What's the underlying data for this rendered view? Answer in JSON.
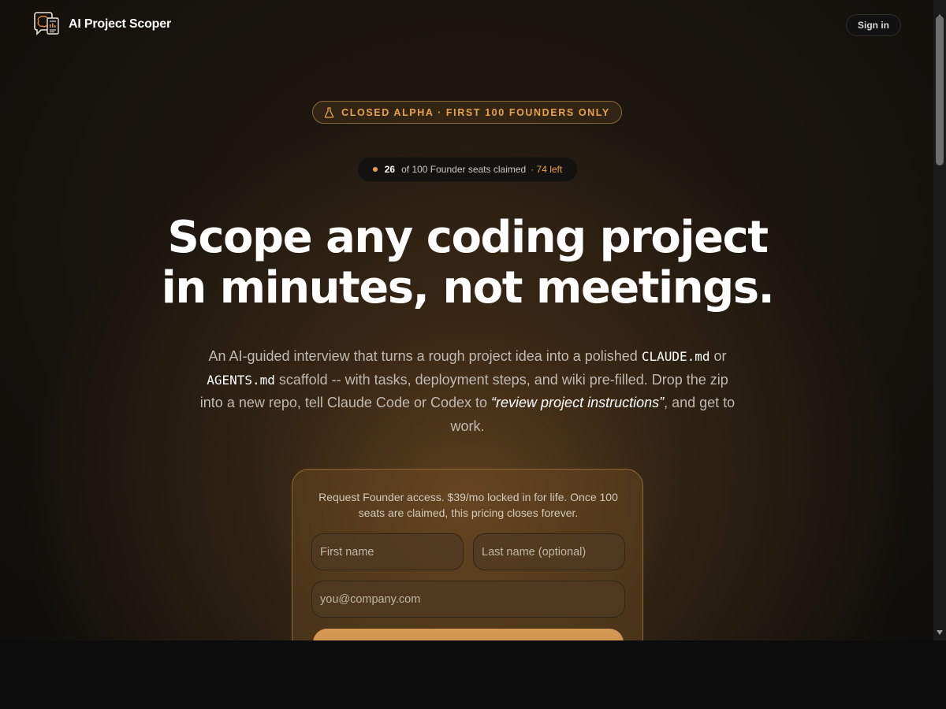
{
  "header": {
    "brand_name": "AI Project Scoper",
    "logo_icon": "brain-document-logo-icon",
    "sign_in_label": "Sign in"
  },
  "badge": {
    "icon": "flask-icon",
    "label": "CLOSED ALPHA · FIRST 100 FOUNDERS ONLY"
  },
  "seats": {
    "claimed": "26",
    "text": "of 100 Founder seats claimed",
    "left": "· 74 left"
  },
  "hero": {
    "headline_line1": "Scope any coding project",
    "headline_line2": "in minutes, not meetings.",
    "sub_part1": "An AI-guided interview that turns a rough project idea into a polished ",
    "sub_code1": "CLAUDE.md",
    "sub_part2": " or ",
    "sub_code2": "AGENTS.md",
    "sub_part3": " scaffold -- with tasks, deployment steps, and wiki pre-filled. Drop the zip into a new repo, tell Claude Code or Codex to ",
    "sub_emphasis": "“review project instructions”",
    "sub_part4": ", and get to work."
  },
  "form": {
    "intro": "Request Founder access. $39/mo locked in for life. Once 100 seats are claimed, this pricing closes forever.",
    "first_name_placeholder": "First name",
    "last_name_placeholder": "Last name (optional)",
    "email_placeholder": "you@company.com"
  },
  "colors": {
    "accent": "#e9a24a",
    "background": "#0f0e0c",
    "card_border": "#8f6a38"
  }
}
